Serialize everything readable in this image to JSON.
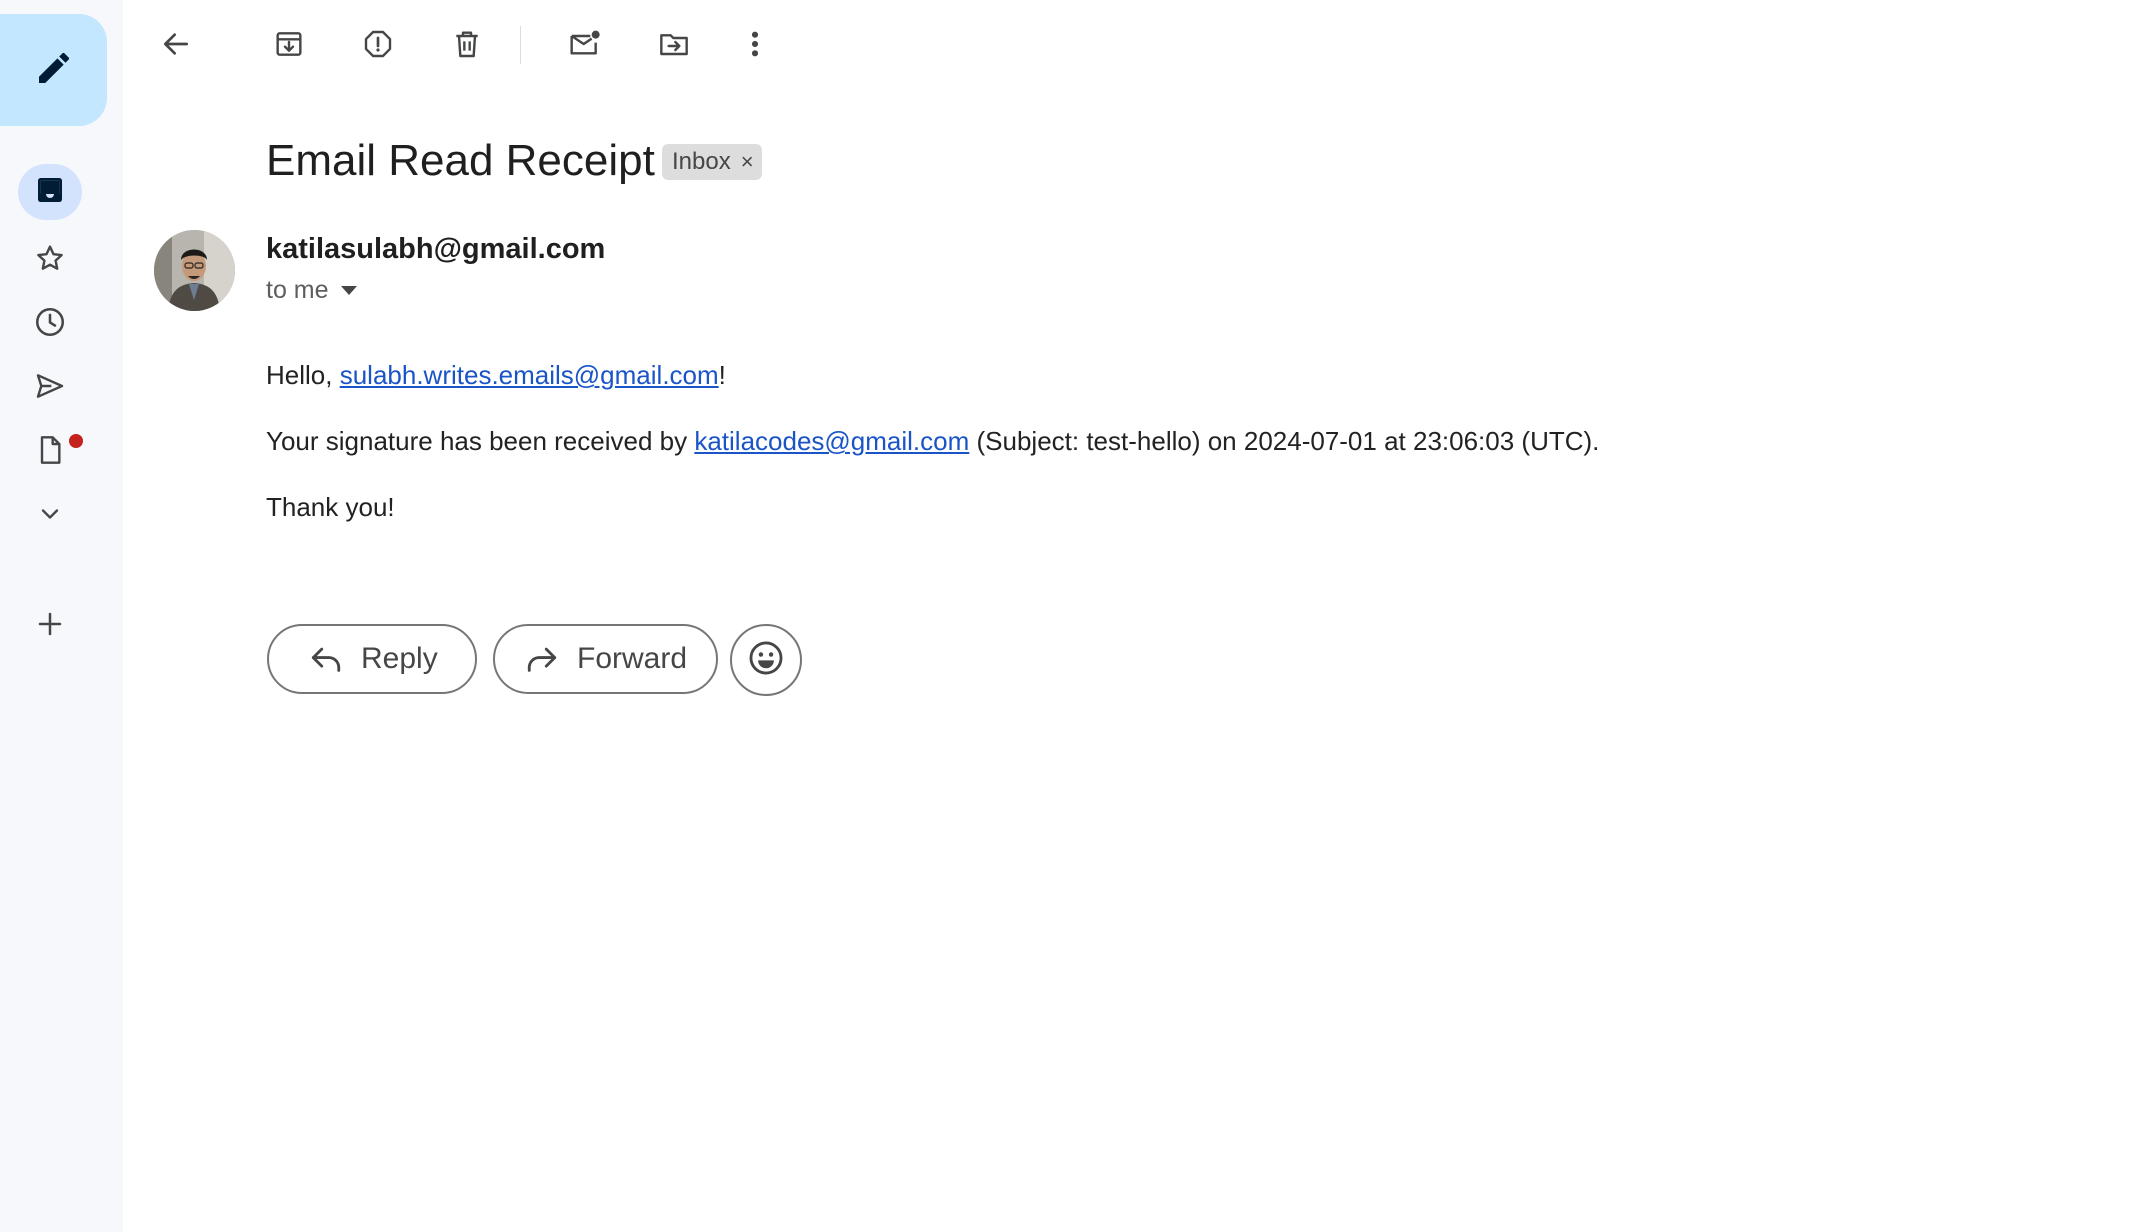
{
  "app": {
    "accent_color": "#c2e7ff",
    "link_color": "#1a55c8",
    "notification_color": "#c5221f"
  },
  "rail": {
    "compose_icon": "pencil-icon",
    "items": [
      {
        "name": "inbox",
        "icon": "inbox-icon",
        "active": true
      },
      {
        "name": "starred",
        "icon": "star-icon",
        "active": false
      },
      {
        "name": "snoozed",
        "icon": "clock-icon",
        "active": false
      },
      {
        "name": "sent",
        "icon": "send-icon",
        "active": false
      },
      {
        "name": "drafts",
        "icon": "draft-icon",
        "active": false,
        "has_notification": true
      },
      {
        "name": "more",
        "icon": "chevron-down-icon",
        "active": false
      },
      {
        "name": "create-label",
        "icon": "plus-icon",
        "active": false
      }
    ]
  },
  "toolbar": {
    "items": [
      "back-arrow-icon",
      "archive-icon",
      "report-spam-icon",
      "delete-icon",
      "mark-unread-icon",
      "move-to-icon",
      "more-vert-icon"
    ]
  },
  "email": {
    "subject": "Email Read Receipt",
    "label": "Inbox",
    "label_close": "×",
    "sender": "katilasulabh@gmail.com",
    "recipient": "to me",
    "body": {
      "greeting_prefix": "Hello, ",
      "greeting_link": "sulabh.writes.emails@gmail.com",
      "greeting_suffix": "!",
      "line2_prefix": "Your signature has been received by ",
      "line2_link": "katilacodes@gmail.com",
      "line2_suffix": " (Subject: test-hello) on 2024-07-01 at 23:06:03 (UTC).",
      "closing": "Thank you!"
    }
  },
  "actions": {
    "reply_label": "Reply",
    "forward_label": "Forward",
    "emoji_icon": "smiley-icon"
  }
}
